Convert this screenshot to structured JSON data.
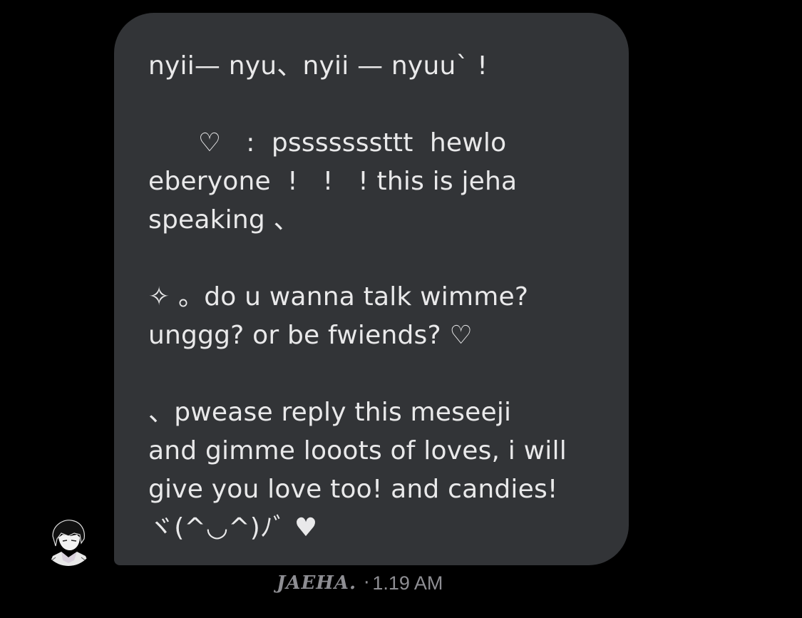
{
  "message": {
    "lines": [
      "nyii— nyu、nyii — nyuu` !",
      "",
      "      ♡   :  psssssssttt  hewlo",
      "eberyone  !   !   ! this is jeha",
      "speaking 、",
      "",
      "✧ 。do u wanna talk wimme?",
      "unggg? or be fwiends? ♡",
      "",
      "、pwease reply this meseeji",
      "and gimme looots of loves, i will",
      "give you love too! and candies!",
      "ヾ(^◡^)ﾉﾞ ♥"
    ]
  },
  "meta": {
    "sender": "JAEHA.",
    "separator": "·",
    "time": "1.19 AM"
  },
  "colors": {
    "background": "#000000",
    "bubble": "#323437",
    "text": "#e9e9ea",
    "meta": "#8e8e93"
  }
}
